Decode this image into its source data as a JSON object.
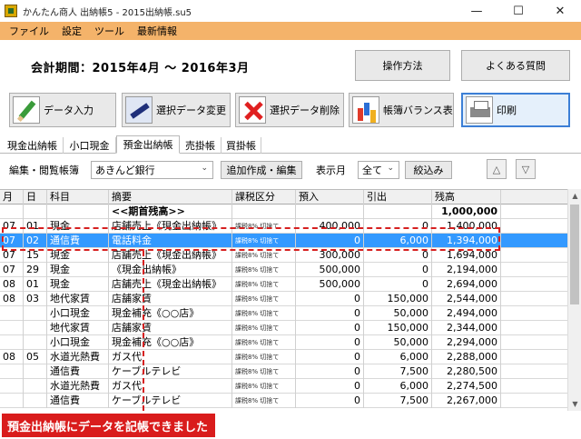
{
  "window": {
    "title": "かんたん商人 出納帳5 - 2015出納帳.su5",
    "minimize": "—",
    "maximize": "☐",
    "close": "✕"
  },
  "menu": [
    "ファイル",
    "設定",
    "ツール",
    "最新情報"
  ],
  "header": {
    "period": "会計期間：2015年4月 〜 2016年3月",
    "howto_label": "操作方法",
    "faq_label": "よくある質問"
  },
  "toolbar": {
    "entry_label": "データ入力",
    "change_label": "選択データ変更",
    "delete_label": "選択データ削除",
    "balance_label": "帳簿バランス表",
    "print_label": "印刷"
  },
  "tabs": [
    "現金出納帳",
    "小口現金",
    "預金出納帳",
    "売掛帳",
    "買掛帳"
  ],
  "active_tab": 2,
  "filter": {
    "ledger_label": "編集・閲覧帳簿",
    "ledger_value": "あきんど銀行",
    "add_label": "追加作成・編集",
    "month_label": "表示月",
    "month_value": "全て",
    "narrow_label": "絞込み",
    "up_label": "△",
    "down_label": "▽"
  },
  "table": {
    "columns": [
      "月",
      "日",
      "科目",
      "摘要",
      "課税区分",
      "預入",
      "引出",
      "残高"
    ],
    "rows": [
      {
        "month": "",
        "day": "",
        "account": "",
        "desc": "<<期首残高>>",
        "tax": "",
        "in": "",
        "out": "",
        "balance": "1,000,000",
        "bold": true
      },
      {
        "month": "07",
        "day": "01",
        "account": "現金",
        "desc": "店舗売上《現金出納帳》",
        "tax": "課税8% 切捨て",
        "in": "400,000",
        "out": "0",
        "balance": "1,400,000"
      },
      {
        "month": "07",
        "day": "02",
        "account": "通信費",
        "desc": "電話料金",
        "tax": "課税8% 切捨て",
        "in": "0",
        "out": "6,000",
        "balance": "1,394,000",
        "selected": true
      },
      {
        "month": "07",
        "day": "15",
        "account": "現金",
        "desc": "店舗売上《現金出納帳》",
        "tax": "課税8% 切捨て",
        "in": "300,000",
        "out": "0",
        "balance": "1,694,000"
      },
      {
        "month": "07",
        "day": "29",
        "account": "現金",
        "desc": "《現金出納帳》",
        "tax": "課税8% 切捨て",
        "in": "500,000",
        "out": "0",
        "balance": "2,194,000"
      },
      {
        "month": "08",
        "day": "01",
        "account": "現金",
        "desc": "店舗売上《現金出納帳》",
        "tax": "課税8% 切捨て",
        "in": "500,000",
        "out": "0",
        "balance": "2,694,000"
      },
      {
        "month": "08",
        "day": "03",
        "account": "地代家賃",
        "desc": "店舗家賃",
        "tax": "課税8% 切捨て",
        "in": "0",
        "out": "150,000",
        "balance": "2,544,000"
      },
      {
        "month": "",
        "day": "",
        "account": "小口現金",
        "desc": "現金補充《○○店》",
        "tax": "課税8% 切捨て",
        "in": "0",
        "out": "50,000",
        "balance": "2,494,000"
      },
      {
        "month": "",
        "day": "",
        "account": "地代家賃",
        "desc": "店舗家賃",
        "tax": "課税8% 切捨て",
        "in": "0",
        "out": "150,000",
        "balance": "2,344,000"
      },
      {
        "month": "",
        "day": "",
        "account": "小口現金",
        "desc": "現金補充《○○店》",
        "tax": "課税8% 切捨て",
        "in": "0",
        "out": "50,000",
        "balance": "2,294,000"
      },
      {
        "month": "08",
        "day": "05",
        "account": "水道光熱費",
        "desc": "ガス代",
        "tax": "課税8% 切捨て",
        "in": "0",
        "out": "6,000",
        "balance": "2,288,000"
      },
      {
        "month": "",
        "day": "",
        "account": "通信費",
        "desc": "ケーブルテレビ",
        "tax": "課税8% 切捨て",
        "in": "0",
        "out": "7,500",
        "balance": "2,280,500"
      },
      {
        "month": "",
        "day": "",
        "account": "水道光熱費",
        "desc": "ガス代",
        "tax": "課税8% 切捨て",
        "in": "0",
        "out": "6,000",
        "balance": "2,274,500"
      },
      {
        "month": "",
        "day": "",
        "account": "通信費",
        "desc": "ケーブルテレビ",
        "tax": "課税8% 切捨て",
        "in": "0",
        "out": "7,500",
        "balance": "2,267,000"
      }
    ]
  },
  "caption": "預金出納帳にデータを記帳できました",
  "colors": {
    "menu_bg": "#f4b36a",
    "selected_row": "#3399ff",
    "annotation_red": "#d91c1c"
  }
}
